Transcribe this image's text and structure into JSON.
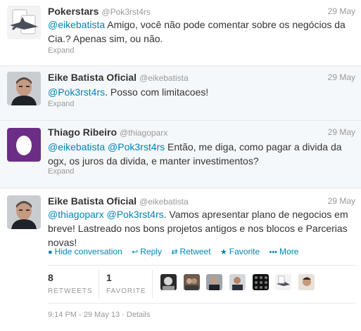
{
  "tweets": [
    {
      "name": "Pokerstars",
      "handle": "@Pok3rst4rs",
      "date": "29 May",
      "parts": [
        {
          "t": "@eikebatista",
          "m": true
        },
        {
          "t": " Amigo, você não pode comentar sobre os negócios da Cia.? Apenas sim, ou não.",
          "m": false
        }
      ],
      "expand": "Expand"
    },
    {
      "name": "Eike Batista Oficial",
      "handle": "@eikebatista",
      "date": "29 May",
      "parts": [
        {
          "t": "@Pok3rst4rs",
          "m": true
        },
        {
          "t": ". Posso com limitacoes!",
          "m": false
        }
      ],
      "expand": "Expand"
    },
    {
      "name": "Thiago Ribeiro",
      "handle": "@thiagoparx",
      "date": "29 May",
      "parts": [
        {
          "t": "@eikebatista",
          "m": true
        },
        {
          "t": " ",
          "m": false
        },
        {
          "t": "@Pok3rst4rs",
          "m": true
        },
        {
          "t": " Então, me diga, como pagar a divida da ogx, os juros da divida, e manter investimentos?",
          "m": false
        }
      ],
      "expand": "Expand"
    },
    {
      "name": "Eike Batista Oficial",
      "handle": "@eikebatista",
      "date": "29 May",
      "parts": [
        {
          "t": "@thiagoparx",
          "m": true
        },
        {
          "t": " ",
          "m": false
        },
        {
          "t": "@Pok3rst4rs",
          "m": true
        },
        {
          "t": ". Vamos apresentar plano de negocios em breve! Lastreado nos bons projetos antigos e nos blocos e Parcerias novas!",
          "m": false
        }
      ]
    }
  ],
  "actions": {
    "hide_conversation": "Hide conversation",
    "reply": "Reply",
    "retweet": "Retweet",
    "favorite": "Favorite",
    "more": "More"
  },
  "stats": {
    "retweets_count": "8",
    "retweets_label": "RETWEETS",
    "favorites_count": "1",
    "favorites_label": "FAVORITE"
  },
  "timestamp": "9:14 PM - 29 May 13 · Details",
  "colors": {
    "link": "#0084b4",
    "muted": "#999999",
    "egg_bg": "#6b2d86"
  }
}
